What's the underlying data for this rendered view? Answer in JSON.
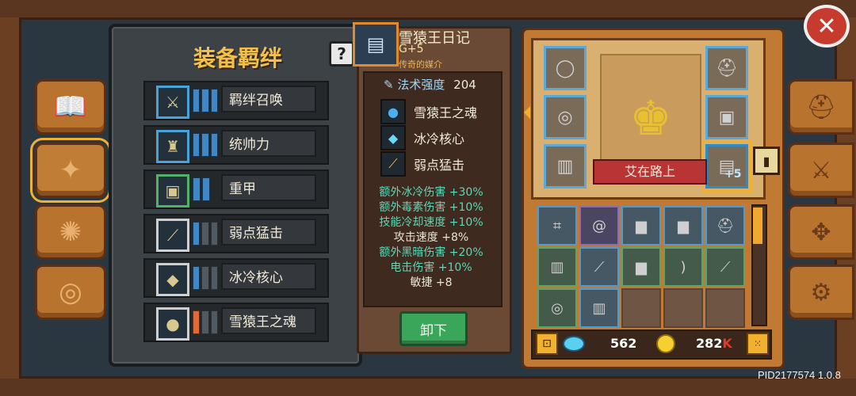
{
  "bonds": {
    "title": "装备羁绊",
    "help_label": "?",
    "rows": [
      {
        "label": "羁绊召唤",
        "icon": "summon-bond-icon"
      },
      {
        "label": "统帅力",
        "icon": "leadership-icon"
      },
      {
        "label": "重甲",
        "icon": "heavy-armor-icon"
      },
      {
        "label": "弱点猛击",
        "icon": "weakness-strike-icon"
      },
      {
        "label": "冰冷核心",
        "icon": "frost-core-icon"
      },
      {
        "label": "雪猿王之魂",
        "icon": "yeti-soul-icon"
      }
    ]
  },
  "item": {
    "name": "雪猿王日记",
    "grade": "G+5",
    "rarity": "传奇的媒介",
    "magic_label": "法术强度",
    "magic_value": "204",
    "skills": [
      {
        "label": "雪猿王之魂"
      },
      {
        "label": "冰冷核心"
      },
      {
        "label": "弱点猛击"
      }
    ],
    "stats": [
      "额外冰冷伤害 +30%",
      "额外毒素伤害 +10%",
      "技能冷却速度 +10%",
      "攻击速度 +8%",
      "额外黑暗伤害 +20%",
      "电击伤害 +10%",
      "敏捷 +8"
    ],
    "unequip_label": "卸下"
  },
  "equipment": {
    "status_ribbon": "艾在路上",
    "upgrade_badge": "+5"
  },
  "currency": {
    "gems": "562",
    "coins": "282",
    "coins_suffix": "K"
  },
  "footer": {
    "pid": "PID2177574 1.0.8"
  },
  "colors": {
    "accent": "#f0b030",
    "title": "#f2c14a",
    "stat_teal": "#5fd6b8",
    "unequip": "#3aa65a"
  }
}
